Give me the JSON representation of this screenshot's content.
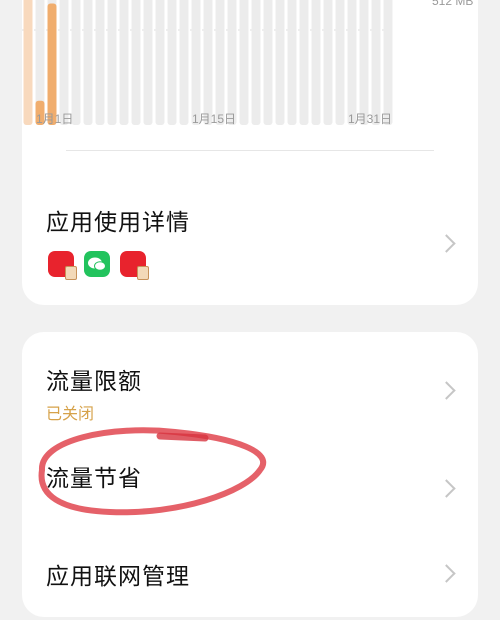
{
  "chart": {
    "y_label": "512 MB",
    "x_ticks": [
      "1月1日",
      "1月15日",
      "1月31日"
    ],
    "daily_usage_fraction": [
      1.0,
      0.18,
      0.9
    ]
  },
  "app_usage": {
    "title": "应用使用详情",
    "icons": [
      "red-app-icon",
      "wechat-icon",
      "red-app-icon"
    ]
  },
  "rows": [
    {
      "title": "流量限额",
      "status": "已关闭"
    },
    {
      "title": "流量节省"
    },
    {
      "title": "应用联网管理"
    }
  ],
  "colors": {
    "accent_orange": "#f0ad6d",
    "bar_empty": "#ececec",
    "status_gold": "#d6a24a",
    "annotation_red": "#e0454f"
  }
}
